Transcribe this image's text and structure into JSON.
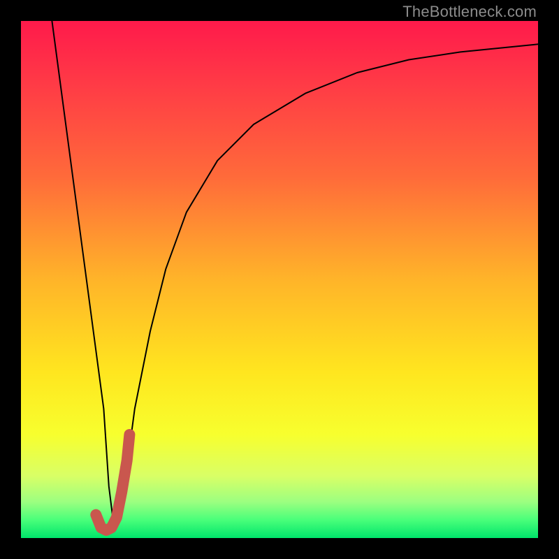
{
  "watermark": "TheBottleneck.com",
  "chart_data": {
    "type": "line",
    "title": "",
    "xlabel": "",
    "ylabel": "",
    "xlim": [
      0,
      100
    ],
    "ylim": [
      0,
      100
    ],
    "grid": false,
    "legend": false,
    "series": [
      {
        "name": "curve",
        "x": [
          6,
          8,
          10,
          12,
          14,
          16,
          17,
          18,
          20,
          22,
          25,
          28,
          32,
          38,
          45,
          55,
          65,
          75,
          85,
          95,
          100
        ],
        "y": [
          100,
          85,
          70,
          55,
          40,
          25,
          10,
          2,
          10,
          25,
          40,
          52,
          63,
          73,
          80,
          86,
          90,
          92.5,
          94,
          95,
          95.5
        ],
        "stroke": "#000000",
        "stroke_width": 2
      },
      {
        "name": "highlight-j",
        "x": [
          14.5,
          15.5,
          16.5,
          17.5,
          18.5,
          19.5,
          20.5,
          21.0
        ],
        "y": [
          4.5,
          2.0,
          1.5,
          2.0,
          4.0,
          9.0,
          15.0,
          20.0
        ],
        "stroke": "#c9574e",
        "stroke_width": 16
      }
    ],
    "background_gradient": {
      "stops": [
        {
          "offset": 0.0,
          "color": "#ff1a4b"
        },
        {
          "offset": 0.12,
          "color": "#ff3a46"
        },
        {
          "offset": 0.3,
          "color": "#ff6a3a"
        },
        {
          "offset": 0.5,
          "color": "#ffb429"
        },
        {
          "offset": 0.68,
          "color": "#ffe61f"
        },
        {
          "offset": 0.8,
          "color": "#f7ff2e"
        },
        {
          "offset": 0.88,
          "color": "#d9ff66"
        },
        {
          "offset": 0.93,
          "color": "#9cff80"
        },
        {
          "offset": 0.965,
          "color": "#49ff7a"
        },
        {
          "offset": 1.0,
          "color": "#00e56b"
        }
      ]
    }
  }
}
